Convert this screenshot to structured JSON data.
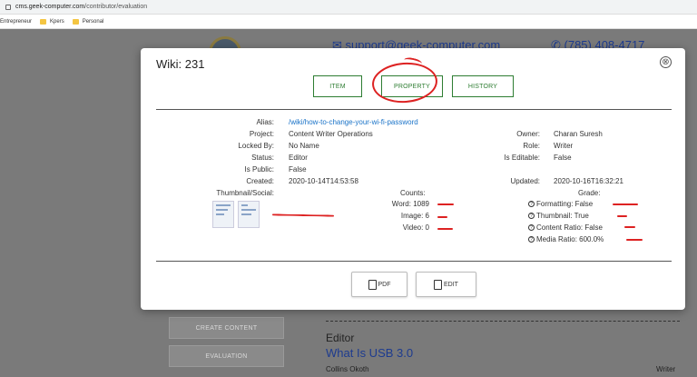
{
  "browser": {
    "url_host": "cms.geek-computer.com",
    "url_path": "/contributor/evaluation",
    "bookmarks": [
      "Entrepreneur",
      "Kpers",
      "Personal"
    ]
  },
  "background": {
    "email": "support@geek-computer.com",
    "phone": "(785) 408-4717",
    "side_buttons": [
      "CREATE CONTENT",
      "EVALUATION"
    ],
    "role": "Editor",
    "title": "What Is USB 3.0",
    "author": "Collins Okoth",
    "author_role": "Writer"
  },
  "modal": {
    "title": "Wiki: 231",
    "close_glyph": "⊗",
    "tabs": {
      "item": "ITEM",
      "property": "PROPERTY",
      "history": "HISTORY"
    },
    "left": {
      "alias_label": "Alias:",
      "alias": "/wiki/how-to-change-your-wi-fi-password",
      "project_label": "Project:",
      "project": "Content Writer Operations",
      "locked_label": "Locked By:",
      "locked": "No Name",
      "status_label": "Status:",
      "status": "Editor",
      "public_label": "Is Public:",
      "public": "False",
      "created_label": "Created:",
      "created": "2020-10-14T14:53:58",
      "thumb_label": "Thumbnail/Social:"
    },
    "right": {
      "owner_label": "Owner:",
      "owner": "Charan Suresh",
      "role_label": "Role:",
      "role": "Writer",
      "editable_label": "Is Editable:",
      "editable": "False",
      "updated_label": "Updated:",
      "updated": "2020-10-16T16:32:21"
    },
    "counts": {
      "heading": "Counts:",
      "word": "Word: 1089",
      "image": "Image: 6",
      "video": "Video: 0"
    },
    "grade": {
      "heading": "Grade:",
      "formatting": "Formatting: False",
      "thumbnail": "Thumbnail: True",
      "content_ratio": "Content Ratio: False",
      "media_ratio": "Media Ratio: 600.0%"
    },
    "actions": {
      "pdf": "PDF",
      "edit": "EDIT"
    }
  }
}
